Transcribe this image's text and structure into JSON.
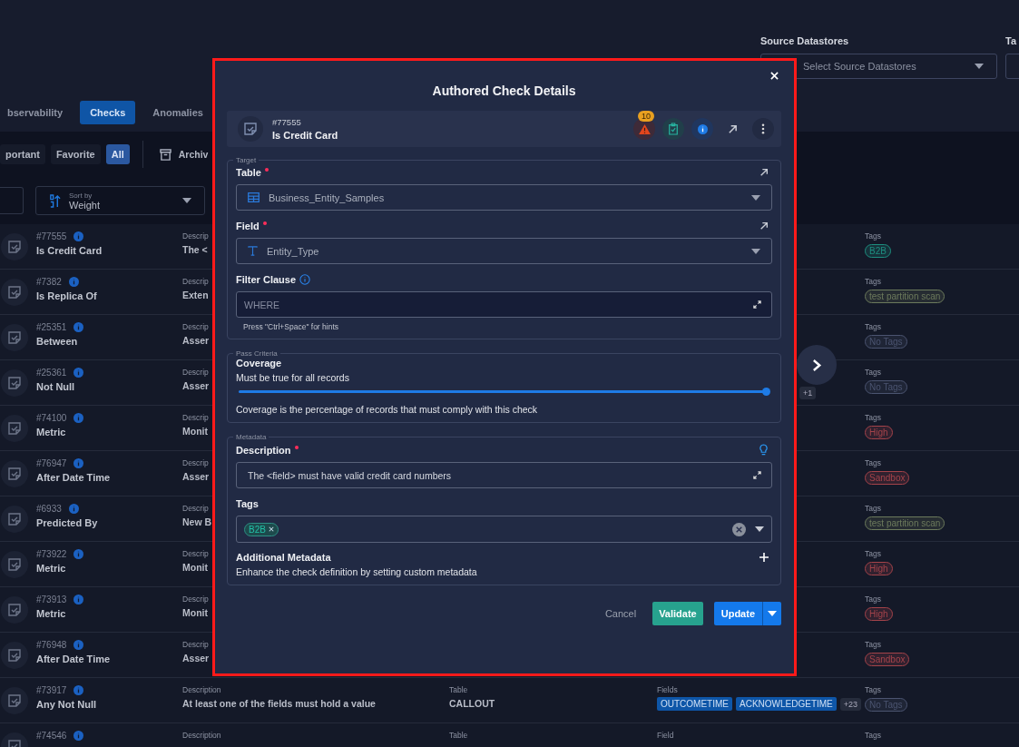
{
  "filters": {
    "source_label": "Source Datastores",
    "source_placeholder": "Select Source Datastores",
    "next_label": "Ta"
  },
  "tabs": [
    {
      "label": "bservability",
      "selected": false
    },
    {
      "label": "Checks",
      "selected": true
    },
    {
      "label": "Anomalies",
      "selected": false
    }
  ],
  "quick_filters": [
    {
      "label": "portant",
      "selected": false
    },
    {
      "label": "Favorite",
      "selected": false
    },
    {
      "label": "All",
      "selected": true
    }
  ],
  "archive_label": "Archiv",
  "sort": {
    "label": "Sort by",
    "value": "Weight"
  },
  "checks": [
    {
      "id": "#77555",
      "name": "Is Credit Card",
      "description_label": "Descrip",
      "description": "The <",
      "tags_label": "Tags",
      "tags": [
        {
          "label": "B2B",
          "color": "#1d8f80"
        }
      ]
    },
    {
      "id": "#7382",
      "name": "Is Replica Of",
      "description_label": "Descrip",
      "description": "Exten",
      "tags_label": "Tags",
      "tags": [
        {
          "label": "test partition scan",
          "color": "#6c7a5c"
        }
      ]
    },
    {
      "id": "#25351",
      "name": "Between",
      "description_label": "Descrip",
      "description": "Asser",
      "tags_label": "Tags",
      "tags": [
        {
          "label": "No Tags",
          "color": "#4b5470"
        }
      ]
    },
    {
      "id": "#25361",
      "name": "Not Null",
      "description_label": "Descrip",
      "description": "Asser",
      "fields_more": "+1",
      "tags_label": "Tags",
      "tags": [
        {
          "label": "No Tags",
          "color": "#4b5470"
        }
      ]
    },
    {
      "id": "#74100",
      "name": "Metric",
      "description_label": "Descrip",
      "description": "Monit",
      "tags_label": "Tags",
      "tags": [
        {
          "label": "High",
          "color": "#a4434a"
        }
      ]
    },
    {
      "id": "#76947",
      "name": "After Date Time",
      "description_label": "Descrip",
      "description": "Asser",
      "tags_label": "Tags",
      "tags": [
        {
          "label": "Sandbox",
          "color": "#a4434a"
        }
      ]
    },
    {
      "id": "#6933",
      "name": "Predicted By",
      "description_label": "Descrip",
      "description": "New B",
      "tags_label": "Tags",
      "tags": [
        {
          "label": "test partition scan",
          "color": "#6c7a5c"
        }
      ]
    },
    {
      "id": "#73922",
      "name": "Metric",
      "description_label": "Descrip",
      "description": "Monit",
      "tags_label": "Tags",
      "tags": [
        {
          "label": "High",
          "color": "#a4434a"
        }
      ]
    },
    {
      "id": "#73913",
      "name": "Metric",
      "description_label": "Descrip",
      "description": "Monit",
      "tags_label": "Tags",
      "tags": [
        {
          "label": "High",
          "color": "#a4434a"
        }
      ]
    },
    {
      "id": "#76948",
      "name": "After Date Time",
      "description_label": "Descrip",
      "description": "Asser",
      "tags_label": "Tags",
      "tags": [
        {
          "label": "Sandbox",
          "color": "#a4434a"
        }
      ]
    },
    {
      "id": "#73917",
      "name": "Any Not Null",
      "description_label": "Description",
      "description": "At least one of the fields must hold a value",
      "table_label": "Table",
      "table": "CALLOUT",
      "fields_label": "Fields",
      "fields": [
        "OUTCOMETIME",
        "ACKNOWLEDGETIME"
      ],
      "fields_more": "+23",
      "tags_label": "Tags",
      "tags": [
        {
          "label": "No Tags",
          "color": "#4b5470"
        }
      ]
    },
    {
      "id": "#74546",
      "description_label": "Description",
      "table_label": "Table",
      "fields_label": "Field",
      "tags_label": "Tags"
    }
  ],
  "modal": {
    "title": "Authored Check Details",
    "check": {
      "id": "#77555",
      "name": "Is Credit Card",
      "anomaly_count": "10"
    },
    "target": {
      "legend": "Target",
      "table_label": "Table",
      "table_required": true,
      "table_value": "Business_Entity_Samples",
      "field_label": "Field",
      "field_required": true,
      "field_value": "Entity_Type",
      "filter_label": "Filter Clause",
      "filter_placeholder": "WHERE",
      "filter_hint": "Press \"Ctrl+Space\" for hints"
    },
    "pass_criteria": {
      "legend": "Pass Criteria",
      "label": "Coverage",
      "rule": "Must be true for all records",
      "level": 1,
      "note": "Coverage is the percentage of records that must comply with this check"
    },
    "metadata": {
      "legend": "Metadata",
      "description_label": "Description",
      "description_required": true,
      "description": "The <field> must have valid credit card numbers",
      "tags_label": "Tags",
      "tags": [
        "B2B"
      ],
      "additional_label": "Additional Metadata",
      "additional_note": "Enhance the check definition by setting custom metadata"
    },
    "buttons": {
      "cancel": "Cancel",
      "validate": "Validate",
      "update": "Update"
    }
  }
}
